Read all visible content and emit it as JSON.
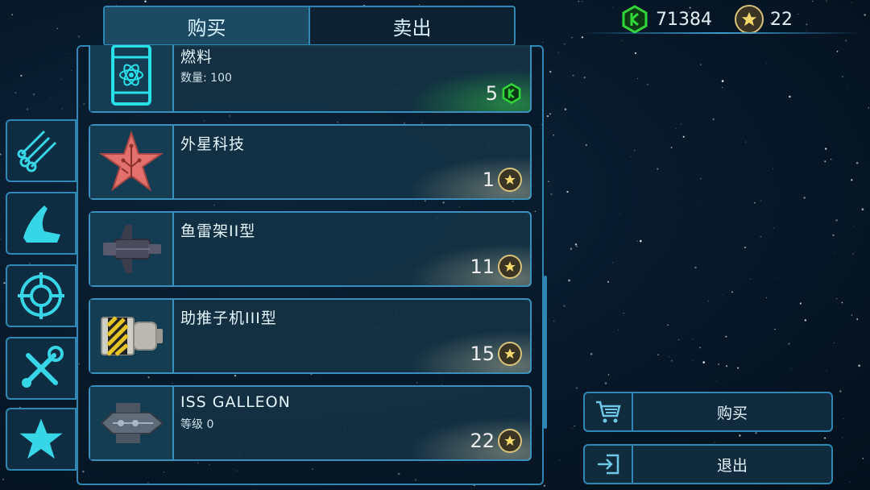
{
  "tabs": {
    "buy": "购买",
    "sell": "卖出"
  },
  "currency": {
    "crystals": "71384",
    "stars": "22"
  },
  "items": [
    {
      "name": "燃料",
      "sub": "数量: 100",
      "price": "5",
      "currency": "crystal",
      "icon": "fuel-barrel-icon"
    },
    {
      "name": "外星科技",
      "sub": "",
      "price": "1",
      "currency": "star",
      "icon": "alien-tech-star-icon"
    },
    {
      "name": "鱼雷架II型",
      "sub": "",
      "price": "11",
      "currency": "star",
      "icon": "torpedo-rack-icon"
    },
    {
      "name": "助推子机III型",
      "sub": "",
      "price": "15",
      "currency": "star",
      "icon": "booster-module-icon"
    },
    {
      "name": "ISS GALLEON",
      "sub": "等级 0",
      "price": "22",
      "currency": "star",
      "icon": "ship-galleon-icon"
    }
  ],
  "sidebar": [
    "materials-icon",
    "ship-hull-icon",
    "target-icon",
    "tools-icon",
    "star-icon"
  ],
  "actions": {
    "buy": "购买",
    "exit": "退出"
  },
  "colors": {
    "accent": "#2f87b4",
    "crystal": "#31d63a",
    "coin": "#d9c27a"
  }
}
